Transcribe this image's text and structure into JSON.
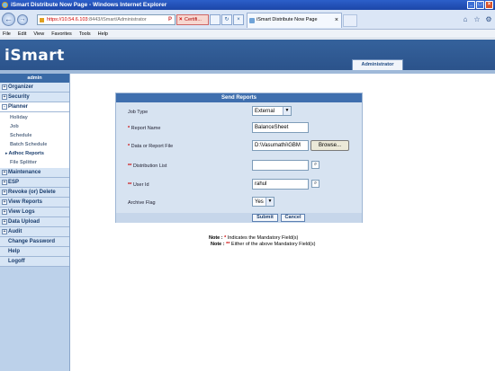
{
  "window": {
    "title": "iSmart Distribute Now Page - Windows Internet Explorer",
    "min": "_",
    "max": "□",
    "close": "×"
  },
  "browser": {
    "back": "←",
    "forward": "→",
    "url_host": "https://10.54.6.103",
    "url_path": ":8443/iSmart/Administrator",
    "search_go": "P",
    "refresh": "↻",
    "cert_label": "Certifi...",
    "cert_x": "×",
    "tab_title": "iSmart Distribute Now Page",
    "tab_close": "×",
    "icon_home": "⌂",
    "icon_favorites": "☆",
    "icon_tools": "⚙"
  },
  "menu": [
    "File",
    "Edit",
    "View",
    "Favorites",
    "Tools",
    "Help"
  ],
  "app": {
    "logo": "iSmart",
    "role_tab": "Administrator"
  },
  "sidebar": {
    "title": "admin",
    "items": [
      {
        "label": "Organizer",
        "plus": "+"
      },
      {
        "label": "Security",
        "plus": "+"
      },
      {
        "label": "Planner",
        "plus": "-"
      }
    ],
    "planner_sub": [
      "Holiday",
      "Job",
      "Schedule",
      "Batch Schedule",
      "Adhoc Reports",
      "File Splitter"
    ],
    "items_after": [
      {
        "label": "Maintenance",
        "plus": "+"
      },
      {
        "label": "ESP",
        "plus": "+"
      },
      {
        "label": "Revoke (or) Delete",
        "plus": "+"
      },
      {
        "label": "View Reports",
        "plus": "+"
      },
      {
        "label": "View Logs",
        "plus": "+"
      },
      {
        "label": "Data Upload",
        "plus": "+"
      },
      {
        "label": "Audit",
        "plus": "+"
      }
    ],
    "plain_items": [
      "Change Password",
      "Help",
      "Logoff"
    ]
  },
  "form": {
    "title": "Send Reports",
    "job_type_label": "Job Type",
    "job_type_value": "External",
    "report_name_label": "Report Name",
    "report_name_value": "BalanceSheet",
    "data_file_label": "Data or Report File",
    "data_file_value": "D:\\Vasumathi\\GBM",
    "browse_label": "Browse...",
    "dist_list_label": "Distribution List",
    "dist_list_value": "",
    "user_id_label": "User Id",
    "user_id_value": "rahul",
    "archive_label": "Archive Flag",
    "archive_value": "Yes",
    "submit_label": "Submit",
    "cancel_label": "Cancel",
    "single_star": "*",
    "double_star": "**",
    "dropdown_arrow": "▼",
    "lookup_glyph": "⌕"
  },
  "notes": {
    "note_prefix": "Note :",
    "note1_text": " Indicates the Mandatory Field(s)",
    "note2_text": " Either of the above Mandatory Field(s)"
  }
}
